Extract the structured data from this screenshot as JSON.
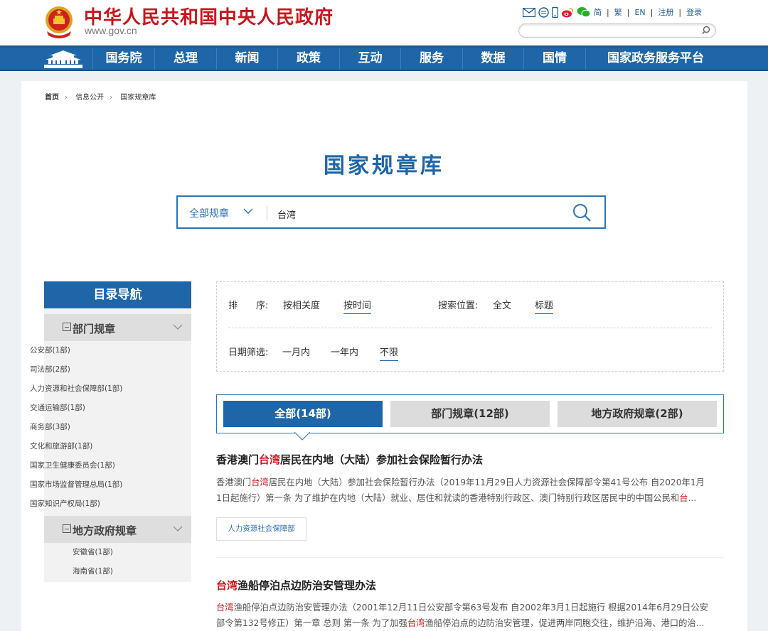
{
  "header": {
    "site_title": "中华人民共和国中央人民政府",
    "site_url": "www.gov.cn",
    "top_links": [
      "简",
      "繁",
      "EN",
      "注册",
      "登录"
    ],
    "top_icons": [
      "mail-icon",
      "message-icon",
      "mobile-icon",
      "weibo-icon",
      "wechat-icon"
    ],
    "search_placeholder": ""
  },
  "nav": {
    "items": [
      "国务院",
      "总理",
      "新闻",
      "政策",
      "互动",
      "服务",
      "数据",
      "国情",
      "国家政务服务平台"
    ]
  },
  "breadcrumb": [
    "首页",
    "信息公开",
    "国家规章库"
  ],
  "page_title": "国家规章库",
  "search": {
    "scope": "全部规章",
    "value": "台湾"
  },
  "sidebar": {
    "heading": "目录导航",
    "groups": [
      {
        "label": "部门规章",
        "items": [
          "公安部(1部)",
          "司法部(2部)",
          "人力资源和社会保障部(1部)",
          "交通运输部(1部)",
          "商务部(3部)",
          "文化和旅游部(1部)",
          "国家卫生健康委员会(1部)",
          "国家市场监督管理总局(1部)",
          "国家知识产权局(1部)"
        ]
      },
      {
        "label": "地方政府规章",
        "items": [
          "安徽省(1部)",
          "海南省(1部)"
        ]
      }
    ]
  },
  "filters": {
    "sort_label": "排　　序:",
    "sort_options": [
      "按相关度",
      "按时间"
    ],
    "sort_selected": "按时间",
    "position_label": "搜索位置:",
    "position_options": [
      "全文",
      "标题"
    ],
    "position_selected": "标题",
    "date_label": "日期筛选:",
    "date_options": [
      "一月内",
      "一年内",
      "不限"
    ],
    "date_selected": "不限"
  },
  "tabs": [
    {
      "label": "全部(14部)",
      "active": true
    },
    {
      "label": "部门规章(12部)",
      "active": false
    },
    {
      "label": "地方政府规章(2部)",
      "active": false
    }
  ],
  "results": [
    {
      "title": [
        "香港澳门",
        "台湾",
        "居民在内地（大陆）参加社会保险暂行办法"
      ],
      "snippet_line1": [
        "香港澳门",
        "台湾",
        "居民在内地（大陆）参加社会保险暂行办法（2019年11月29日人力资源社会保障部令第41号公布 自2020年1月"
      ],
      "snippet_line2": [
        "1日起施行）第一条 为了维护在内地（大陆）就业、居住和就读的香港特别行政区、澳门特别行政区居民中的中国公民和",
        "台",
        "..."
      ],
      "tag": "人力资源社会保障部"
    },
    {
      "title": [
        "台湾",
        "渔船停泊点边防治安管理办法"
      ],
      "snippet_line1": [
        "台湾",
        "渔船停泊点边防治安管理办法（2001年12月11日公安部令第63号发布 自2002年3月1日起施行 根据2014年6月29日公安"
      ],
      "snippet_line2": [
        "部令第132号修正）第一章 总则 第一条 为了加强",
        "台湾",
        "渔船停泊点的边防治安管理，促进两岸同胞交往，维护沿海、港口的治..."
      ]
    }
  ],
  "colors": {
    "brand_blue": "#1e66a8",
    "title_red": "#c8161e",
    "highlight_red": "#d2141d"
  }
}
